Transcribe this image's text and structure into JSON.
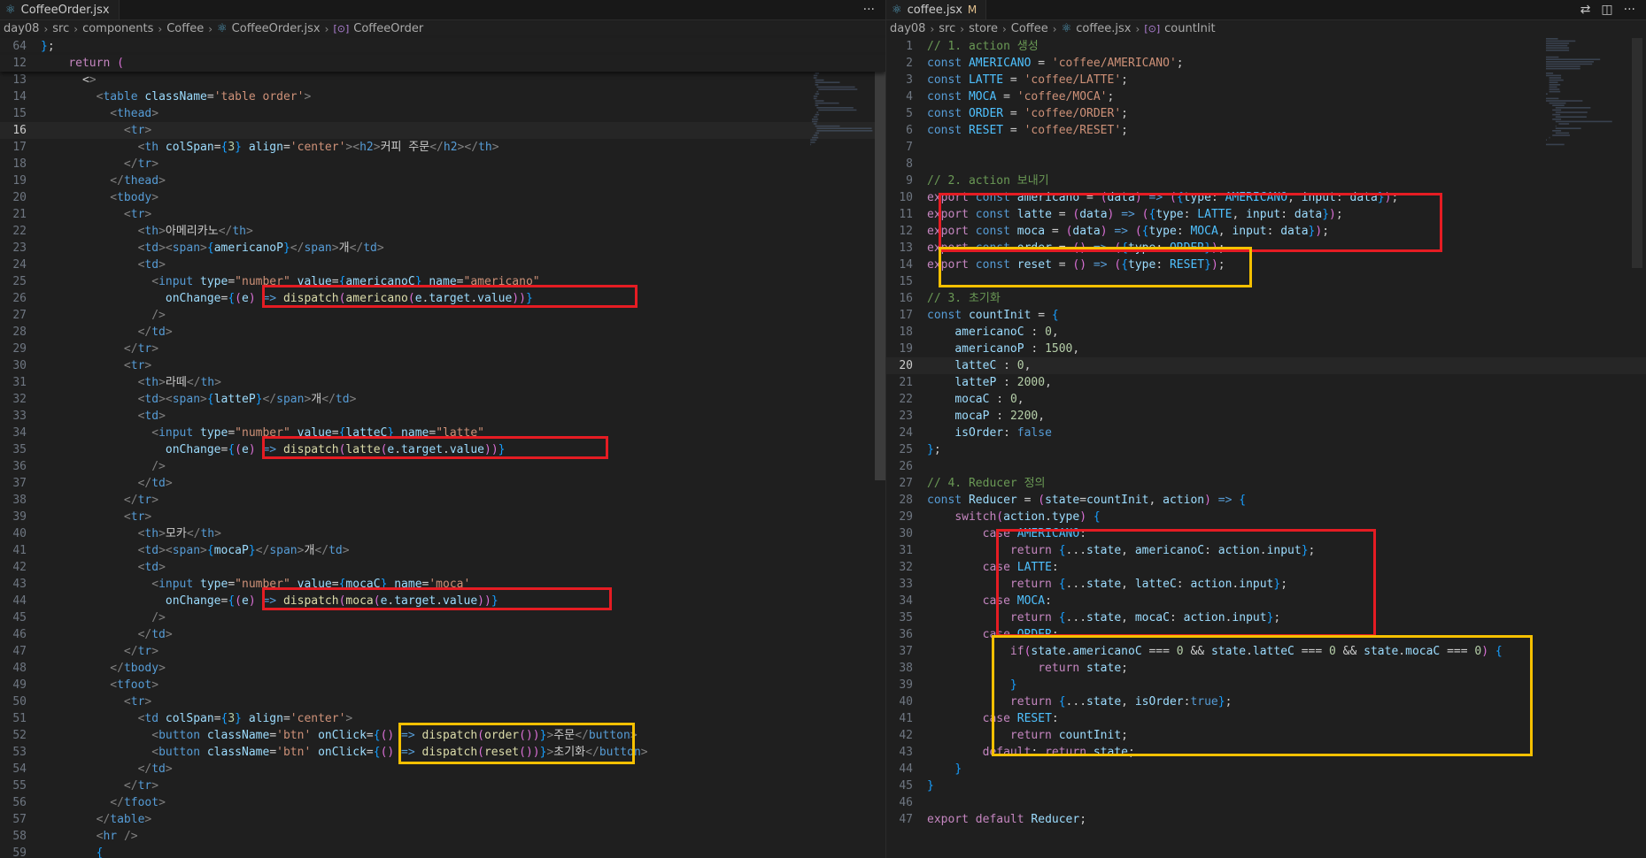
{
  "left": {
    "tab": {
      "icon": "react-icon",
      "title": "CoffeeOrder.jsx"
    },
    "more": "···",
    "breadcrumb": [
      "day08",
      "src",
      "components",
      "Coffee",
      "CoffeeOrder.jsx",
      "CoffeeOrder"
    ],
    "sticky": [
      {
        "n": "64",
        "text": "};"
      },
      {
        "n": "12",
        "text": "    return ("
      }
    ],
    "lines": [
      {
        "n": "13",
        "text": "      <>"
      },
      {
        "n": "14",
        "text": "        <table className='table order'>"
      },
      {
        "n": "15",
        "text": "          <thead>"
      },
      {
        "n": "16",
        "text": "            <tr>"
      },
      {
        "n": "17",
        "text": "              <th colSpan={3} align='center'><h2>커피 주문</h2></th>"
      },
      {
        "n": "18",
        "text": "            </tr>"
      },
      {
        "n": "19",
        "text": "          </thead>"
      },
      {
        "n": "20",
        "text": "          <tbody>"
      },
      {
        "n": "21",
        "text": "            <tr>"
      },
      {
        "n": "22",
        "text": "              <th>아메리카노</th>"
      },
      {
        "n": "23",
        "text": "              <td><span>{americanoP}</span>개</td>"
      },
      {
        "n": "24",
        "text": "              <td>"
      },
      {
        "n": "25",
        "text": "                <input type=\"number\" value={americanoC} name=\"americano\""
      },
      {
        "n": "26",
        "text": "                  onChange={(e) => dispatch(americano(e.target.value))}"
      },
      {
        "n": "27",
        "text": "                />"
      },
      {
        "n": "28",
        "text": "              </td>"
      },
      {
        "n": "29",
        "text": "            </tr>"
      },
      {
        "n": "30",
        "text": "            <tr>"
      },
      {
        "n": "31",
        "text": "              <th>라떼</th>"
      },
      {
        "n": "32",
        "text": "              <td><span>{latteP}</span>개</td>"
      },
      {
        "n": "33",
        "text": "              <td>"
      },
      {
        "n": "34",
        "text": "                <input type=\"number\" value={latteC} name=\"latte\""
      },
      {
        "n": "35",
        "text": "                  onChange={(e) => dispatch(latte(e.target.value))}"
      },
      {
        "n": "36",
        "text": "                />"
      },
      {
        "n": "37",
        "text": "              </td>"
      },
      {
        "n": "38",
        "text": "            </tr>"
      },
      {
        "n": "39",
        "text": "            <tr>"
      },
      {
        "n": "40",
        "text": "              <th>모카</th>"
      },
      {
        "n": "41",
        "text": "              <td><span>{mocaP}</span>개</td>"
      },
      {
        "n": "42",
        "text": "              <td>"
      },
      {
        "n": "43",
        "text": "                <input type=\"number\" value={mocaC} name='moca'"
      },
      {
        "n": "44",
        "text": "                  onChange={(e) => dispatch(moca(e.target.value))}"
      },
      {
        "n": "45",
        "text": "                />"
      },
      {
        "n": "46",
        "text": "              </td>"
      },
      {
        "n": "47",
        "text": "            </tr>"
      },
      {
        "n": "48",
        "text": "          </tbody>"
      },
      {
        "n": "49",
        "text": "          <tfoot>"
      },
      {
        "n": "50",
        "text": "            <tr>"
      },
      {
        "n": "51",
        "text": "              <td colSpan={3} align='center'>"
      },
      {
        "n": "52",
        "text": "                <button className='btn' onClick={() => dispatch(order())}>주문</button>"
      },
      {
        "n": "53",
        "text": "                <button className='btn' onClick={() => dispatch(reset())}>초기화</button>"
      },
      {
        "n": "54",
        "text": "              </td>"
      },
      {
        "n": "55",
        "text": "            </tr>"
      },
      {
        "n": "56",
        "text": "          </tfoot>"
      },
      {
        "n": "57",
        "text": "        </table>"
      },
      {
        "n": "58",
        "text": "        <hr />"
      },
      {
        "n": "59",
        "text": "        {"
      }
    ],
    "current_line": "16"
  },
  "right": {
    "tab": {
      "icon": "react-icon",
      "title": "coffee.jsx",
      "modified": "M"
    },
    "actions": [
      "⇄",
      "◫",
      "···"
    ],
    "breadcrumb": [
      "day08",
      "src",
      "store",
      "Coffee",
      "coffee.jsx",
      "countInit"
    ],
    "lines": [
      {
        "n": "1",
        "text": "// 1. action 생성"
      },
      {
        "n": "2",
        "text": "const AMERICANO = 'coffee/AMERICANO';"
      },
      {
        "n": "3",
        "text": "const LATTE = 'coffee/LATTE';"
      },
      {
        "n": "4",
        "text": "const MOCA = 'coffee/MOCA';"
      },
      {
        "n": "5",
        "text": "const ORDER = 'coffee/ORDER';"
      },
      {
        "n": "6",
        "text": "const RESET = 'coffee/RESET';"
      },
      {
        "n": "7",
        "text": ""
      },
      {
        "n": "8",
        "text": ""
      },
      {
        "n": "9",
        "text": "// 2. action 보내기"
      },
      {
        "n": "10",
        "text": "export const americano = (data) => ({type: AMERICANO, input: data});"
      },
      {
        "n": "11",
        "text": "export const latte = (data) => ({type: LATTE, input: data});"
      },
      {
        "n": "12",
        "text": "export const moca = (data) => ({type: MOCA, input: data});"
      },
      {
        "n": "13",
        "text": "export const order = () => ({type: ORDER});"
      },
      {
        "n": "14",
        "text": "export const reset = () => ({type: RESET});"
      },
      {
        "n": "15",
        "text": ""
      },
      {
        "n": "16",
        "text": "// 3. 초기화"
      },
      {
        "n": "17",
        "text": "const countInit = {"
      },
      {
        "n": "18",
        "text": "    americanoC : 0,"
      },
      {
        "n": "19",
        "text": "    americanoP : 1500,"
      },
      {
        "n": "20",
        "text": "    latteC : 0,"
      },
      {
        "n": "21",
        "text": "    latteP : 2000,"
      },
      {
        "n": "22",
        "text": "    mocaC : 0,"
      },
      {
        "n": "23",
        "text": "    mocaP : 2200,"
      },
      {
        "n": "24",
        "text": "    isOrder: false"
      },
      {
        "n": "25",
        "text": "};"
      },
      {
        "n": "26",
        "text": ""
      },
      {
        "n": "27",
        "text": "// 4. Reducer 정의"
      },
      {
        "n": "28",
        "text": "const Reducer = (state=countInit, action) => {"
      },
      {
        "n": "29",
        "text": "    switch(action.type) {"
      },
      {
        "n": "30",
        "text": "        case AMERICANO:"
      },
      {
        "n": "31",
        "text": "            return {...state, americanoC: action.input};"
      },
      {
        "n": "32",
        "text": "        case LATTE:"
      },
      {
        "n": "33",
        "text": "            return {...state, latteC: action.input};"
      },
      {
        "n": "34",
        "text": "        case MOCA:"
      },
      {
        "n": "35",
        "text": "            return {...state, mocaC: action.input};"
      },
      {
        "n": "36",
        "text": "        case ORDER:"
      },
      {
        "n": "37",
        "text": "            if(state.americanoC === 0 && state.latteC === 0 && state.mocaC === 0) {"
      },
      {
        "n": "38",
        "text": "                return state;"
      },
      {
        "n": "39",
        "text": "            }"
      },
      {
        "n": "40",
        "text": "            return {...state, isOrder:true};"
      },
      {
        "n": "41",
        "text": "        case RESET:"
      },
      {
        "n": "42",
        "text": "            return countInit;"
      },
      {
        "n": "43",
        "text": "        default: return state;"
      },
      {
        "n": "44",
        "text": "    }"
      },
      {
        "n": "45",
        "text": "}"
      },
      {
        "n": "46",
        "text": ""
      },
      {
        "n": "47",
        "text": "export default Reducer;"
      }
    ],
    "current_line": "20"
  },
  "colors": {
    "background": "#1f1f1f",
    "red_box": "#e51c23",
    "yellow_box": "#f5c000",
    "keyword": "#569cd6",
    "string": "#ce9178",
    "comment": "#6a9955",
    "variable": "#9cdcfe",
    "function": "#dcdcaa",
    "constant": "#4fc1ff"
  }
}
